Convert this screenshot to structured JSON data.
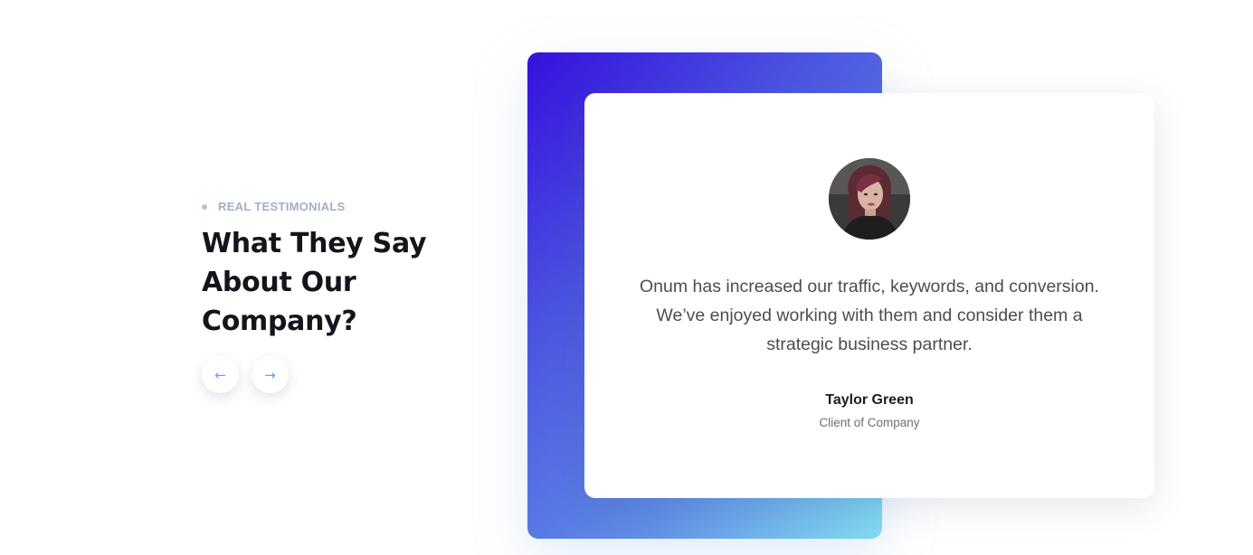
{
  "section": {
    "eyebrow": "REAL TESTIMONIALS",
    "heading": "What They Say About Our Company?"
  },
  "nav": {
    "prev_icon": "arrow-left-icon",
    "next_icon": "arrow-right-icon",
    "prev_glyph": "←",
    "next_glyph": "→"
  },
  "testimonial": {
    "quote": "Onum has increased our traffic, keywords, and conversion. We’ve enjoyed working with them and consider them a strategic business partner.",
    "name": "Taylor Green",
    "role": "Client of Company"
  },
  "colors": {
    "accent": "#63a4ea",
    "gradient_start": "#3510de",
    "gradient_end": "#82dcf0",
    "heading": "#14151c"
  }
}
